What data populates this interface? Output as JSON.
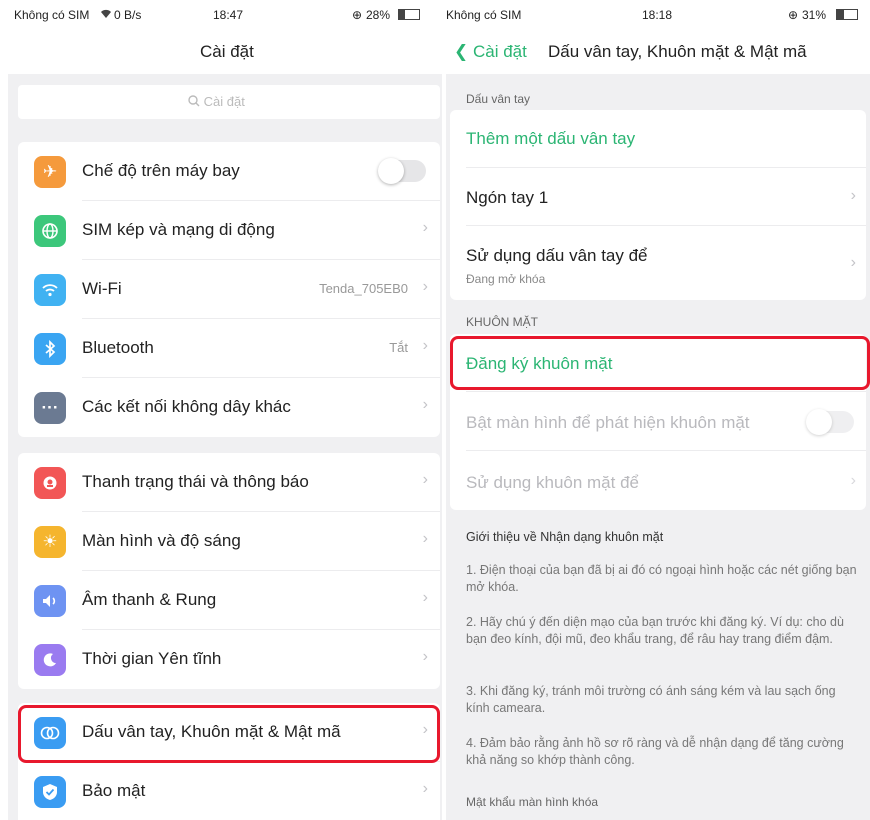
{
  "left": {
    "status": {
      "carrier": "Không có SIM",
      "speed": "0 B/s",
      "time": "18:47",
      "battery": "28%"
    },
    "title": "Cài đặt",
    "search_placeholder": "Cài đặt",
    "group1": [
      {
        "label": "Chế độ trên máy bay",
        "toggle": "off",
        "icon": "airplane-icon",
        "color": "#f59a3c"
      },
      {
        "label": "SIM kép và mạng di động",
        "icon": "globe-icon",
        "color": "#3cc77b"
      },
      {
        "label": "Wi-Fi",
        "value": "Tenda_705EB0",
        "icon": "wifi-icon",
        "color": "#40b2f2"
      },
      {
        "label": "Bluetooth",
        "value": "Tắt",
        "icon": "bluetooth-icon",
        "color": "#3aa5f2"
      },
      {
        "label": "Các kết nối không dây khác",
        "icon": "more-icon",
        "color": "#6b7a92"
      }
    ],
    "group2": [
      {
        "label": "Thanh trạng thái và thông báo",
        "icon": "notification-icon",
        "color": "#f25656"
      },
      {
        "label": "Màn hình và độ sáng",
        "icon": "brightness-icon",
        "color": "#f5b52e"
      },
      {
        "label": "Âm thanh & Rung",
        "icon": "speaker-icon",
        "color": "#6e93f2"
      },
      {
        "label": "Thời gian Yên tĩnh",
        "icon": "moon-icon",
        "color": "#9a7bf0"
      }
    ],
    "group3": [
      {
        "label": "Dấu vân tay, Khuôn mặt & Mật mã",
        "icon": "fingerprint-icon",
        "color": "#3a9cf2"
      },
      {
        "label": "Bảo mật",
        "icon": "shield-icon",
        "color": "#3a9cf2"
      }
    ]
  },
  "right": {
    "status": {
      "carrier": "Không có SIM",
      "time": "18:18",
      "battery": "31%"
    },
    "back_label": "Cài đặt",
    "title": "Dấu vân tay, Khuôn mặt & Mật mã",
    "fingerprint_header": "Dấu vân tay",
    "add_fingerprint": "Thêm một dấu vân tay",
    "finger1": "Ngón tay 1",
    "use_fingerprint": "Sử dụng dấu vân tay để",
    "use_fingerprint_sub": "Đang mở khóa",
    "face_header": "KHUÔN MẶT",
    "register_face": "Đăng ký khuôn mặt",
    "wake_screen": "Bật màn hình để phát hiện khuôn mặt",
    "use_face": "Sử dụng khuôn mặt để",
    "intro_title": "Giới thiệu về Nhận dạng khuôn mặt",
    "intro": [
      "1. Điện thoại của bạn đã bị ai đó có ngoại hình hoặc các nét giống bạn mở khóa.",
      "2. Hãy chú ý đến diện mạo của bạn trước khi đăng ký. Ví dụ: cho dù bạn đeo kính, đội mũ, đeo khẩu trang, để râu hay trang điểm đậm.",
      "3. Khi đăng ký, tránh môi trường có ánh sáng kém và lau sạch ống kính cameara.",
      "4. Đảm bảo rằng ảnh hồ sơ rõ ràng và dễ nhận dạng để tăng cường khả năng so khớp thành công."
    ],
    "lock_password_header": "Mật khẩu màn hình khóa"
  }
}
